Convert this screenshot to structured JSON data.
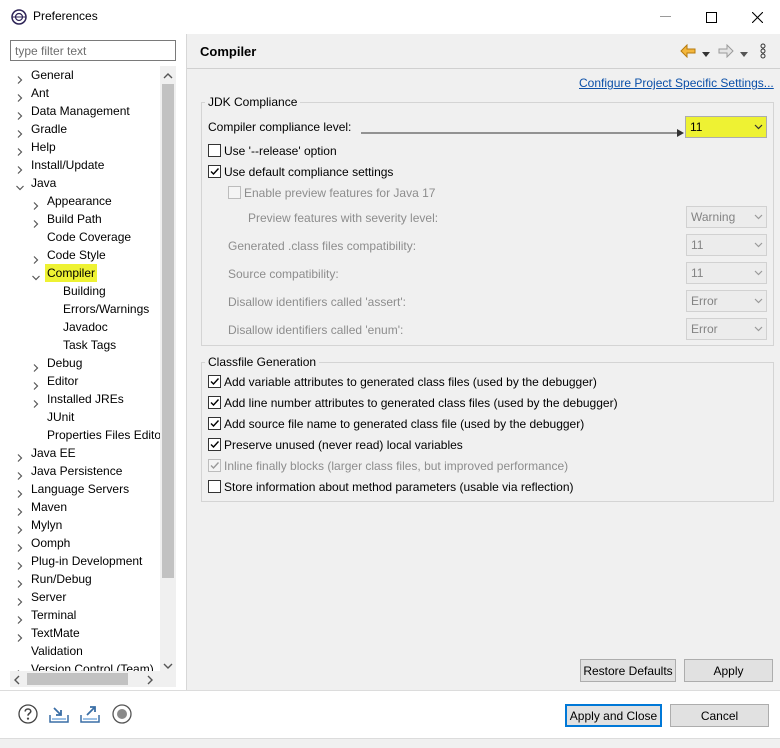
{
  "window": {
    "title": "Preferences"
  },
  "filter": {
    "placeholder": "type filter text"
  },
  "tree": [
    {
      "label": "General",
      "level": 0,
      "chevron": "right"
    },
    {
      "label": "Ant",
      "level": 0,
      "chevron": "right"
    },
    {
      "label": "Data Management",
      "level": 0,
      "chevron": "right"
    },
    {
      "label": "Gradle",
      "level": 0,
      "chevron": "right"
    },
    {
      "label": "Help",
      "level": 0,
      "chevron": "right"
    },
    {
      "label": "Install/Update",
      "level": 0,
      "chevron": "right"
    },
    {
      "label": "Java",
      "level": 0,
      "chevron": "down"
    },
    {
      "label": "Appearance",
      "level": 1,
      "chevron": "right"
    },
    {
      "label": "Build Path",
      "level": 1,
      "chevron": "right"
    },
    {
      "label": "Code Coverage",
      "level": 1,
      "chevron": "none"
    },
    {
      "label": "Code Style",
      "level": 1,
      "chevron": "right"
    },
    {
      "label": "Compiler",
      "level": 1,
      "chevron": "down",
      "selected": true
    },
    {
      "label": "Building",
      "level": 2,
      "chevron": "none"
    },
    {
      "label": "Errors/Warnings",
      "level": 2,
      "chevron": "none"
    },
    {
      "label": "Javadoc",
      "level": 2,
      "chevron": "none"
    },
    {
      "label": "Task Tags",
      "level": 2,
      "chevron": "none"
    },
    {
      "label": "Debug",
      "level": 1,
      "chevron": "right"
    },
    {
      "label": "Editor",
      "level": 1,
      "chevron": "right"
    },
    {
      "label": "Installed JREs",
      "level": 1,
      "chevron": "right"
    },
    {
      "label": "JUnit",
      "level": 1,
      "chevron": "none"
    },
    {
      "label": "Properties Files Edito",
      "level": 1,
      "chevron": "none"
    },
    {
      "label": "Java EE",
      "level": 0,
      "chevron": "right"
    },
    {
      "label": "Java Persistence",
      "level": 0,
      "chevron": "right"
    },
    {
      "label": "Language Servers",
      "level": 0,
      "chevron": "right"
    },
    {
      "label": "Maven",
      "level": 0,
      "chevron": "right"
    },
    {
      "label": "Mylyn",
      "level": 0,
      "chevron": "right"
    },
    {
      "label": "Oomph",
      "level": 0,
      "chevron": "right"
    },
    {
      "label": "Plug-in Development",
      "level": 0,
      "chevron": "right"
    },
    {
      "label": "Run/Debug",
      "level": 0,
      "chevron": "right"
    },
    {
      "label": "Server",
      "level": 0,
      "chevron": "right"
    },
    {
      "label": "Terminal",
      "level": 0,
      "chevron": "right"
    },
    {
      "label": "TextMate",
      "level": 0,
      "chevron": "right"
    },
    {
      "label": "Validation",
      "level": 0,
      "chevron": "none"
    },
    {
      "label": "Version Control (Team)",
      "level": 0,
      "chevron": "right"
    }
  ],
  "page": {
    "title": "Compiler",
    "link": "Configure Project Specific Settings..."
  },
  "jdk": {
    "group_title": "JDK Compliance",
    "compliance_label": "Compiler compliance level:",
    "compliance_value": "11",
    "release_label": "Use '--release' option",
    "release_checked": false,
    "default_label": "Use default compliance settings",
    "default_checked": true,
    "preview_label": "Enable preview features for Java 17",
    "severity_label": "Preview features with severity level:",
    "severity_value": "Warning",
    "generated_label": "Generated .class files compatibility:",
    "generated_value": "11",
    "source_label": "Source compatibility:",
    "source_value": "11",
    "assert_label": "Disallow identifiers called 'assert':",
    "assert_value": "Error",
    "enum_label": "Disallow identifiers called 'enum':",
    "enum_value": "Error"
  },
  "classfile": {
    "group_title": "Classfile Generation",
    "options": [
      {
        "label": "Add variable attributes to generated class files (used by the debugger)",
        "checked": true,
        "disabled": false
      },
      {
        "label": "Add line number attributes to generated class files (used by the debugger)",
        "checked": true,
        "disabled": false
      },
      {
        "label": "Add source file name to generated class file (used by the debugger)",
        "checked": true,
        "disabled": false
      },
      {
        "label": "Preserve unused (never read) local variables",
        "checked": true,
        "disabled": false
      },
      {
        "label": "Inline finally blocks (larger class files, but improved performance)",
        "checked": true,
        "disabled": true
      },
      {
        "label": "Store information about method parameters (usable via reflection)",
        "checked": false,
        "disabled": false
      }
    ]
  },
  "buttons": {
    "restore": "Restore Defaults",
    "apply": "Apply",
    "apply_close": "Apply and Close",
    "cancel": "Cancel"
  },
  "colors": {
    "highlight": "#eef233",
    "link": "#0a4fa8",
    "nav_back": "#e8a317",
    "default_button_border": "#0078d7"
  }
}
